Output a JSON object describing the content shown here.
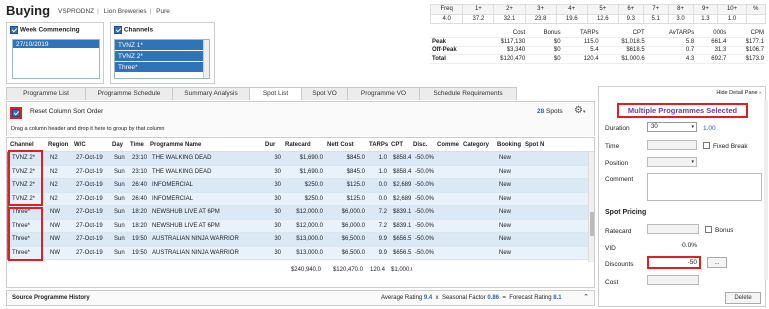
{
  "header": {
    "title": "Buying",
    "crumbs": [
      "VSPRODNZ",
      "Lion Breweries",
      "Pure"
    ]
  },
  "week": {
    "label": "Week Commencing",
    "items": [
      "27/10/2019"
    ]
  },
  "channels": {
    "label": "Channels",
    "items": [
      "TVNZ 1*",
      "TVNZ 2*",
      "Three*"
    ]
  },
  "freq": {
    "header_label": "Freq",
    "headers": [
      "1+",
      "2+",
      "3+",
      "4+",
      "5+",
      "6+",
      "7+",
      "8+",
      "9+",
      "10+"
    ],
    "row_label": "%",
    "values": [
      "4.0",
      "37.2",
      "32.1",
      "23.8",
      "19.6",
      "12.6",
      "9.3",
      "5.1",
      "3.0",
      "1.3",
      "1.0"
    ]
  },
  "stats": {
    "headers": [
      "Cost",
      "Bonus",
      "TARPs",
      "CPT",
      "AvTARPs",
      "000s",
      "CPM"
    ],
    "rows": [
      {
        "label": "Peak",
        "vals": [
          "$117,130",
          "$0",
          "115.0",
          "$1,018.5",
          "5.8",
          "661.4",
          "$177.1"
        ]
      },
      {
        "label": "Off-Peak",
        "vals": [
          "$3,340",
          "$0",
          "5.4",
          "$618.5",
          "0.7",
          "31.3",
          "$106.7"
        ]
      },
      {
        "label": "Total",
        "vals": [
          "$120,470",
          "$0",
          "120.4",
          "$1,000.6",
          "4.3",
          "692.7",
          "$173.9"
        ]
      }
    ]
  },
  "tabs": [
    "Programme List",
    "Programme Schedule",
    "Summary Analysis",
    "Spot List",
    "Spot VO",
    "Programme VO",
    "Schedule Requirements"
  ],
  "toolbar": {
    "reset": "Reset Column Sort Order",
    "spots_count": "28",
    "spots_label": "Spots",
    "group_hint": "Drag a column header and drop it here to group by that column"
  },
  "columns": [
    "Channel",
    "Region",
    "W/C",
    "Day",
    "Time",
    "Programme Name",
    "Dur",
    "Ratecard",
    "Nett Cost",
    "TARPs",
    "CPT",
    "Disc.",
    "Comme",
    "Category",
    "Booking",
    "Spot N"
  ],
  "rows": [
    [
      "TVNZ 2*",
      "N2",
      "27-Oct-19",
      "Sun",
      "23:10",
      "THE WALKING DEAD",
      "30",
      "$1,690.0",
      "$845.0",
      "1.0",
      "$858.4",
      "-50.0%",
      "",
      "",
      "New",
      ""
    ],
    [
      "TVNZ 2*",
      "N2",
      "27-Oct-19",
      "Sun",
      "23:10",
      "THE WALKING DEAD",
      "30",
      "$1,690.0",
      "$845.0",
      "1.0",
      "$858.4",
      "-50.0%",
      "",
      "",
      "New",
      ""
    ],
    [
      "TVNZ 2*",
      "N2",
      "27-Oct-19",
      "Sun",
      "26:40",
      "INFOMERCIAL",
      "30",
      "$250.0",
      "$125.0",
      "0.0",
      "$2,689",
      "-50.0%",
      "",
      "",
      "New",
      ""
    ],
    [
      "TVNZ 2*",
      "N2",
      "27-Oct-19",
      "Sun",
      "26:40",
      "INFOMERCIAL",
      "30",
      "$250.0",
      "$125.0",
      "0.0",
      "$2,689",
      "-50.0%",
      "",
      "",
      "New",
      ""
    ],
    [
      "Three*",
      "NW",
      "27-Oct-19",
      "Sun",
      "18:20",
      "NEWSHUB LIVE AT 6PM",
      "30",
      "$12,000.0",
      "$6,000.0",
      "7.2",
      "$839.1",
      "-50.0%",
      "",
      "",
      "New",
      ""
    ],
    [
      "Three*",
      "NW",
      "27-Oct-19",
      "Sun",
      "18:20",
      "NEWSHUB LIVE AT 6PM",
      "30",
      "$12,000.0",
      "$6,000.0",
      "7.2",
      "$839.1",
      "-50.0%",
      "",
      "",
      "New",
      ""
    ],
    [
      "Three*",
      "NW",
      "27-Oct-19",
      "Sun",
      "19:50",
      "AUSTRALIAN NINJA WARRIOR",
      "30",
      "$13,000.0",
      "$6,500.0",
      "9.9",
      "$656.5",
      "-50.0%",
      "",
      "",
      "New",
      ""
    ],
    [
      "Three*",
      "NW",
      "27-Oct-19",
      "Sun",
      "19:50",
      "AUSTRALIAN NINJA WARRIOR",
      "30",
      "$13,000.0",
      "$6,500.0",
      "9.9",
      "$656.5",
      "-50.0%",
      "",
      "",
      "New",
      ""
    ]
  ],
  "totals": {
    "ratecard": "$240,940.0",
    "nett": "$120,470.0",
    "tarps": "120.4",
    "cpt": "$1,000.6"
  },
  "footer": {
    "title": "Source Programme History",
    "avg_label": "Average Rating",
    "avg": "9.4",
    "x": "x",
    "sf_label": "Seasonal Factor",
    "sf": "0.86",
    "eq": "=",
    "fr_label": "Forecast Rating",
    "fr": "8.1"
  },
  "panel": {
    "hide": "Hide Detail Pane",
    "title": "Multiple Programmes Selected",
    "duration_label": "Duration",
    "duration": "30",
    "ratio": "1.00",
    "time_label": "Time",
    "fixed": "Fixed Break",
    "position_label": "Position",
    "comment_label": "Comment",
    "pricing": "Spot Pricing",
    "ratecard_label": "Ratecard",
    "bonus": "Bonus",
    "vid_label": "VID",
    "vid": "0.0%",
    "discounts_label": "Discounts",
    "discounts": "-50",
    "ellipsis": "...",
    "cost_label": "Cost",
    "delete": "Delete"
  }
}
